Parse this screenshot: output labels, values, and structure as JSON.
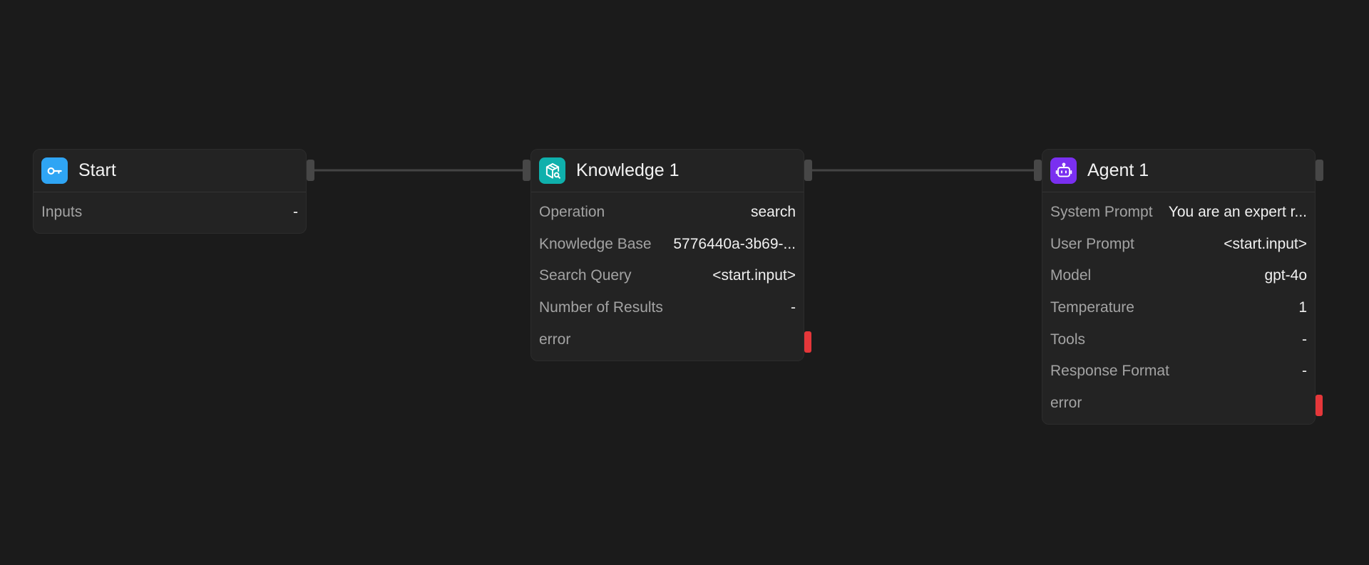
{
  "colors": {
    "canvas_bg": "#1b1b1b",
    "node_bg": "#232323",
    "edge": "#444444",
    "handle": "#474747",
    "error_handle": "#e5373a",
    "start_icon_bg": "#2fa5f4",
    "knowledge_icon_bg": "#0fb0ac",
    "agent_icon_bg": "#7a2ff0"
  },
  "nodes": {
    "start": {
      "title": "Start",
      "icon": "key-icon",
      "rows": [
        {
          "label": "Inputs",
          "value": "-"
        }
      ]
    },
    "knowledge": {
      "title": "Knowledge 1",
      "icon": "package-search-icon",
      "rows": [
        {
          "label": "Operation",
          "value": "search"
        },
        {
          "label": "Knowledge Base",
          "value": "5776440a-3b69-..."
        },
        {
          "label": "Search Query",
          "value": "<start.input>"
        },
        {
          "label": "Number of Results",
          "value": "-"
        },
        {
          "label": "error",
          "value": ""
        }
      ]
    },
    "agent": {
      "title": "Agent 1",
      "icon": "robot-icon",
      "rows": [
        {
          "label": "System Prompt",
          "value": "You are an expert r..."
        },
        {
          "label": "User Prompt",
          "value": "<start.input>"
        },
        {
          "label": "Model",
          "value": "gpt-4o"
        },
        {
          "label": "Temperature",
          "value": "1"
        },
        {
          "label": "Tools",
          "value": "-"
        },
        {
          "label": "Response Format",
          "value": "-"
        },
        {
          "label": "error",
          "value": ""
        }
      ]
    }
  }
}
